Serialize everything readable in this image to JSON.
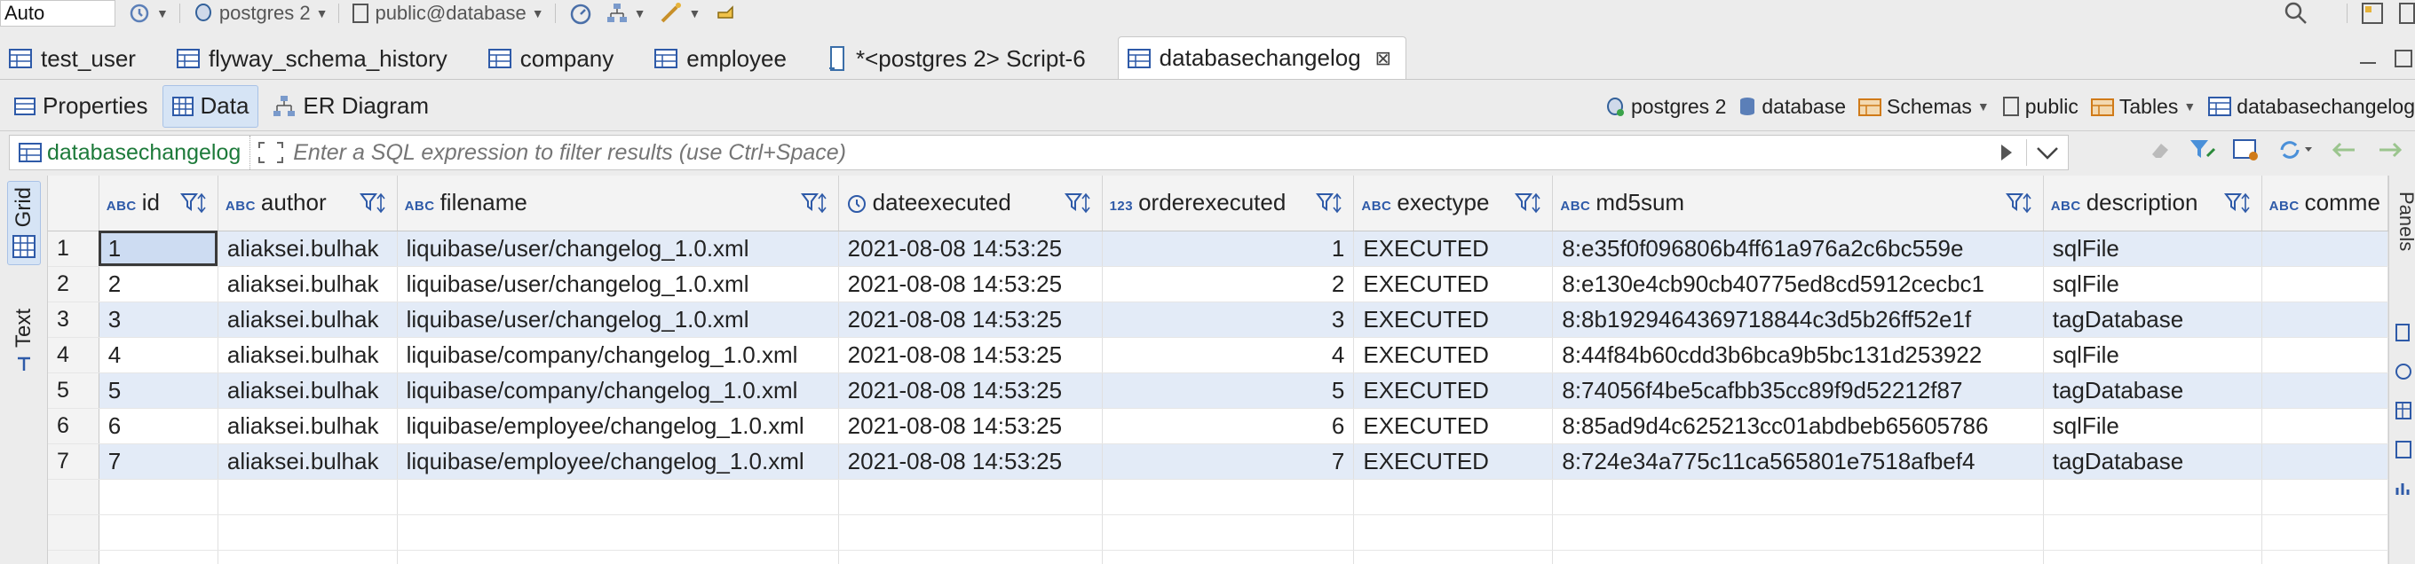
{
  "toolbar": {
    "mode": "Auto",
    "connection": "postgres 2",
    "schema": "public@database"
  },
  "tabs": [
    {
      "label": "test_user",
      "icon": "table-icon"
    },
    {
      "label": "flyway_schema_history",
      "icon": "table-icon"
    },
    {
      "label": "company",
      "icon": "table-icon"
    },
    {
      "label": "employee",
      "icon": "table-icon"
    },
    {
      "label": "*<postgres 2> Script-6",
      "icon": "script-icon"
    },
    {
      "label": "databasechangelog",
      "icon": "table-icon",
      "active": true
    }
  ],
  "subtabs": {
    "properties": "Properties",
    "data": "Data",
    "er": "ER Diagram"
  },
  "breadcrumbs": {
    "connection": "postgres 2",
    "database": "database",
    "schemas": "Schemas",
    "schema": "public",
    "tables": "Tables",
    "table": "databasechangelog"
  },
  "filter": {
    "table": "databasechangelog",
    "placeholder": "Enter a SQL expression to filter results (use Ctrl+Space)"
  },
  "side": {
    "grid": "Grid",
    "text": "Text",
    "panels": "Panels"
  },
  "grid": {
    "columns": [
      {
        "name": "id",
        "type": "ABC"
      },
      {
        "name": "author",
        "type": "ABC"
      },
      {
        "name": "filename",
        "type": "ABC"
      },
      {
        "name": "dateexecuted",
        "type": "clock"
      },
      {
        "name": "orderexecuted",
        "type": "123"
      },
      {
        "name": "exectype",
        "type": "ABC"
      },
      {
        "name": "md5sum",
        "type": "ABC"
      },
      {
        "name": "description",
        "type": "ABC"
      },
      {
        "name": "comme",
        "type": "ABC"
      }
    ],
    "rows": [
      {
        "n": "1",
        "id": "1",
        "author": "aliaksei.bulhak",
        "filename": "liquibase/user/changelog_1.0.xml",
        "dateexecuted": "2021-08-08 14:53:25",
        "orderexecuted": "1",
        "exectype": "EXECUTED",
        "md5sum": "8:e35f0f096806b4ff61a976a2c6bc559e",
        "description": "sqlFile"
      },
      {
        "n": "2",
        "id": "2",
        "author": "aliaksei.bulhak",
        "filename": "liquibase/user/changelog_1.0.xml",
        "dateexecuted": "2021-08-08 14:53:25",
        "orderexecuted": "2",
        "exectype": "EXECUTED",
        "md5sum": "8:e130e4cb90cb40775ed8cd5912cecbc1",
        "description": "sqlFile"
      },
      {
        "n": "3",
        "id": "3",
        "author": "aliaksei.bulhak",
        "filename": "liquibase/user/changelog_1.0.xml",
        "dateexecuted": "2021-08-08 14:53:25",
        "orderexecuted": "3",
        "exectype": "EXECUTED",
        "md5sum": "8:8b1929464369718844c3d5b26ff52e1f",
        "description": "tagDatabase"
      },
      {
        "n": "4",
        "id": "4",
        "author": "aliaksei.bulhak",
        "filename": "liquibase/company/changelog_1.0.xml",
        "dateexecuted": "2021-08-08 14:53:25",
        "orderexecuted": "4",
        "exectype": "EXECUTED",
        "md5sum": "8:44f84b60cdd3b6bca9b5bc131d253922",
        "description": "sqlFile"
      },
      {
        "n": "5",
        "id": "5",
        "author": "aliaksei.bulhak",
        "filename": "liquibase/company/changelog_1.0.xml",
        "dateexecuted": "2021-08-08 14:53:25",
        "orderexecuted": "5",
        "exectype": "EXECUTED",
        "md5sum": "8:74056f4be5cafbb35cc89f9d52212f87",
        "description": "tagDatabase"
      },
      {
        "n": "6",
        "id": "6",
        "author": "aliaksei.bulhak",
        "filename": "liquibase/employee/changelog_1.0.xml",
        "dateexecuted": "2021-08-08 14:53:25",
        "orderexecuted": "6",
        "exectype": "EXECUTED",
        "md5sum": "8:85ad9d4c625213cc01abdbeb65605786",
        "description": "sqlFile"
      },
      {
        "n": "7",
        "id": "7",
        "author": "aliaksei.bulhak",
        "filename": "liquibase/employee/changelog_1.0.xml",
        "dateexecuted": "2021-08-08 14:53:25",
        "orderexecuted": "7",
        "exectype": "EXECUTED",
        "md5sum": "8:724e34a775c11ca565801e7518afbef4",
        "description": "tagDatabase"
      }
    ]
  },
  "colors": {
    "accent": "#2e5aa8",
    "row_alt": "#e3ebf7",
    "filter_table": "#1d7a3a"
  }
}
